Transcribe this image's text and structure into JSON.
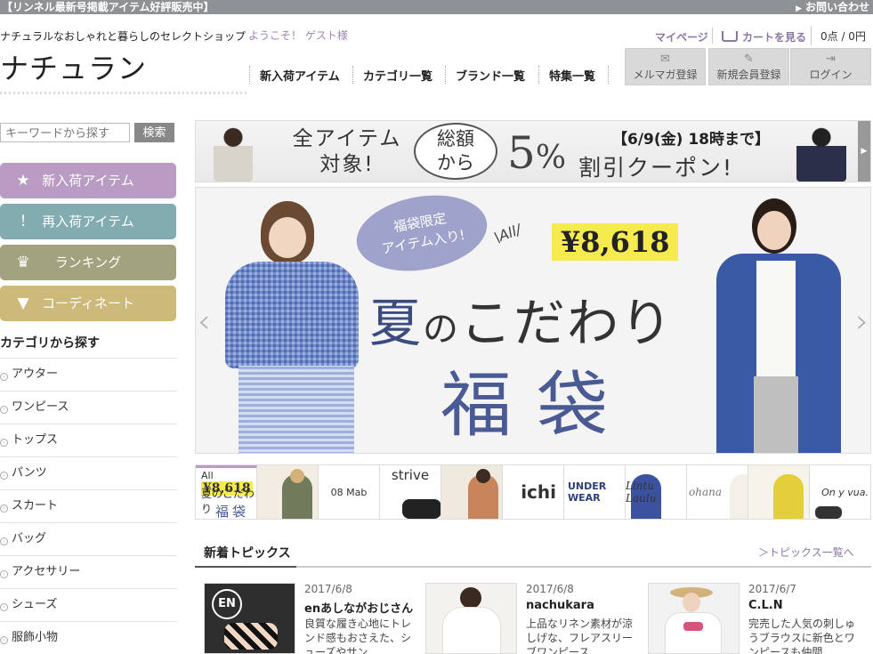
{
  "topbar": {
    "promo": "【リンネル最新号掲載アイテム好評販売中】",
    "contact": "お問い合わせ"
  },
  "header": {
    "tagline": "ナチュラルなおしゃれと暮らしのセレクトショップ",
    "welcome": "ようこそ！ ゲスト様",
    "logo": "ナチュラン",
    "mypage": "マイページ",
    "cart": "カートを見る",
    "points": "0点 / 0円",
    "nav": [
      "新入荷アイテム",
      "カテゴリ一覧",
      "ブランド一覧",
      "特集一覧"
    ],
    "buttons": [
      {
        "icon": "mail-icon",
        "label": "メルマガ登録"
      },
      {
        "icon": "pencil-icon",
        "label": "新規会員登録"
      },
      {
        "icon": "login-icon",
        "label": "ログイン"
      }
    ]
  },
  "sidebar": {
    "search_placeholder": "キーワードから探す",
    "search_button": "検索",
    "feature_buttons": [
      {
        "icon": "star-icon",
        "label": "新入荷アイテム",
        "color": "#b99bc4"
      },
      {
        "icon": "exclamation-icon",
        "label": "再入荷アイテム",
        "color": "#83acb0"
      },
      {
        "icon": "crown-icon",
        "label": "ランキング",
        "color": "#a3a27e"
      },
      {
        "icon": "shirt-icon",
        "label": "コーディネート",
        "color": "#cdb97a"
      }
    ],
    "category_title": "カテゴリから探す",
    "categories": [
      "アウター",
      "ワンピース",
      "トップス",
      "パンツ",
      "スカート",
      "バッグ",
      "アクセサリー",
      "シューズ",
      "服飾小物"
    ]
  },
  "banner_coupon": {
    "all_items": "全アイテム",
    "target": "対象!",
    "bubble_line1": "総額",
    "bubble_line2": "から",
    "discount": "5",
    "pct": "%",
    "coupon": "割引クーポン!",
    "deadline": "【6/9(金) 18時まで】"
  },
  "hero": {
    "bubble_line1": "福袋限定",
    "bubble_line2": "アイテム入り!",
    "all_label": "\\All/",
    "price": "¥8,618",
    "title_a": "夏",
    "title_no": "の",
    "title_rest": "こだわり",
    "subtitle": "福袋"
  },
  "thumbnails": [
    {
      "all": "All",
      "price": "¥8,618",
      "line1": "夏のこだわり",
      "line2": "福袋"
    },
    {
      "label": ""
    },
    {
      "label": "08 Mab"
    },
    {
      "label": "strive"
    },
    {
      "label": ""
    },
    {
      "label": "ichi"
    },
    {
      "label": "UNDER WEAR"
    },
    {
      "label": "Lintu Laulu"
    },
    {
      "label": "ohana"
    },
    {
      "label": ""
    },
    {
      "label": "On y vua."
    }
  ],
  "topics": {
    "title": "新着トピックス",
    "more": "＞トピックス一覧へ",
    "items": [
      {
        "date": "2017/6/8",
        "name": "enあしながおじさん",
        "desc": "良質な履き心地にトレンド感もおさえた、シューズやサン"
      },
      {
        "date": "2017/6/8",
        "name": "nachukara",
        "desc": "上品なリネン素材が涼しげな、フレアスリーブワンピース"
      },
      {
        "date": "2017/6/7",
        "name": "C.L.N",
        "desc": "完売した人気の刺しゅうブラウスに新色とワンピースも仲間"
      }
    ]
  }
}
